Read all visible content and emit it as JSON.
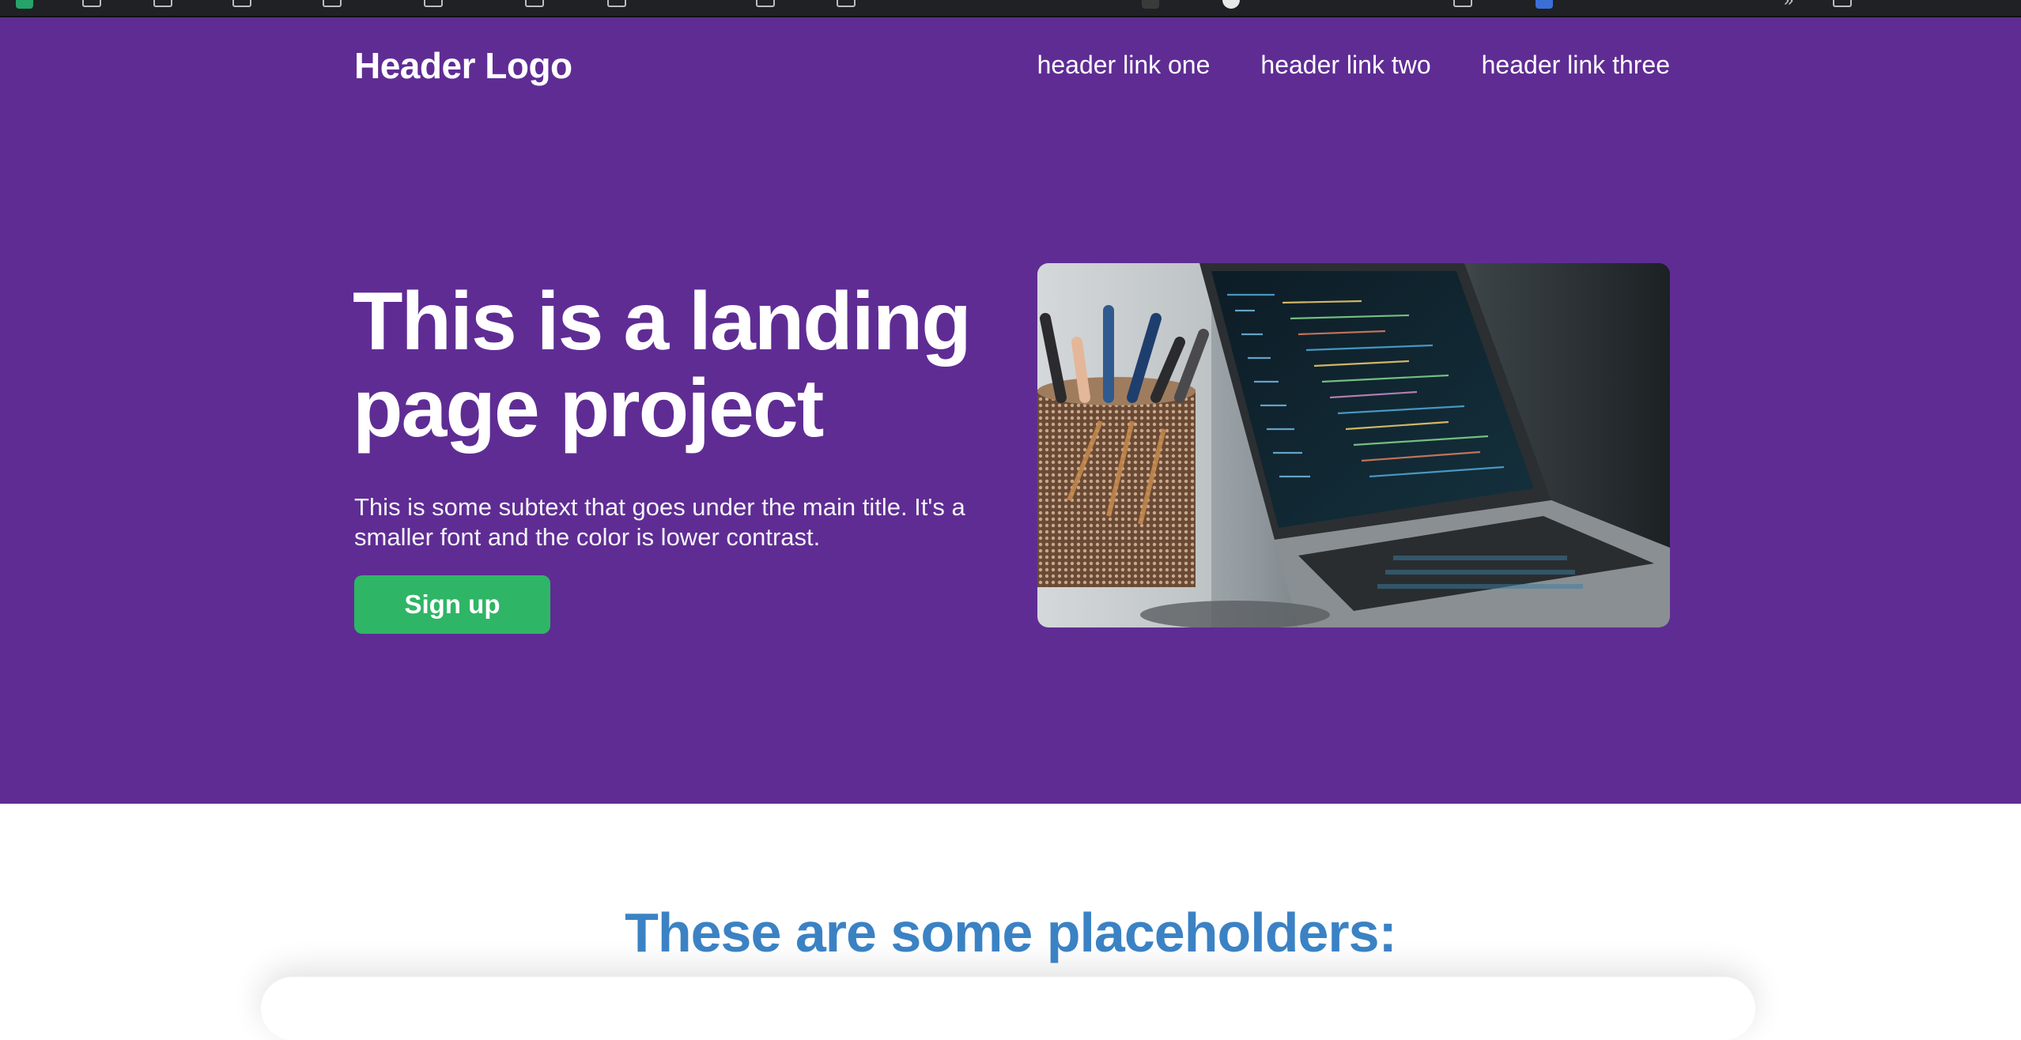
{
  "header": {
    "logo": "Header Logo",
    "links": [
      "header link one",
      "header link two",
      "header link three"
    ]
  },
  "hero": {
    "title": "This is a landing page project",
    "subtext": "This is some subtext that goes under the main title. It's a smaller font and the color is lower contrast.",
    "signup_label": "Sign up",
    "image_alt": "laptop-with-code-icon"
  },
  "section": {
    "title": "These are some placeholders:"
  },
  "colors": {
    "hero_background": "#5f2c94",
    "button": "#2fb566",
    "section_title": "#3b82c4"
  }
}
